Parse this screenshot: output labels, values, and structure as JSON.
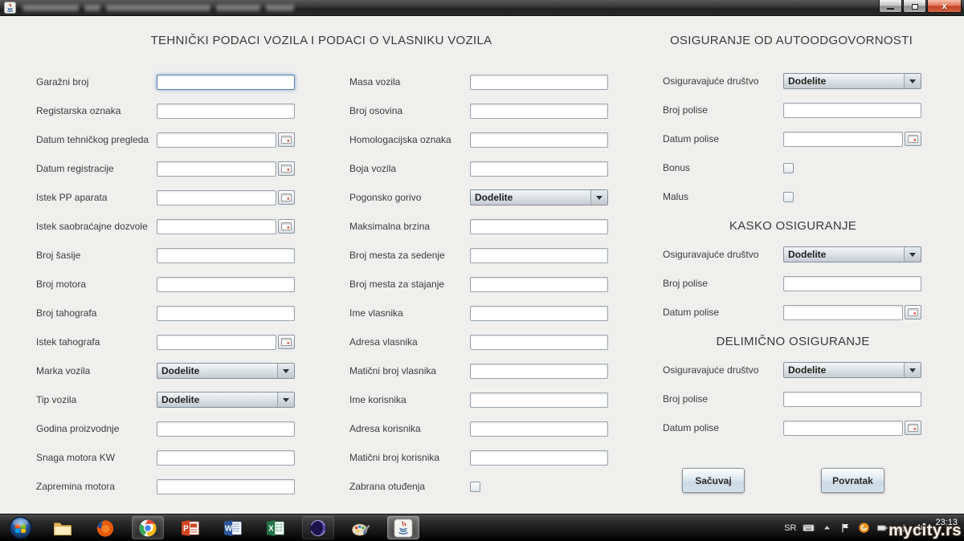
{
  "headings": {
    "main": "TEHNIČKI PODACI VOZILA I PODACI O VLASNIKU VOZILA",
    "autoodgovornost": "OSIGURANJE OD AUTOODGOVORNOSTI"
  },
  "form": {
    "left": [
      {
        "label": "Garažni broj",
        "type": "text",
        "value": "",
        "focused": true
      },
      {
        "label": "Registarska oznaka",
        "type": "text",
        "value": ""
      },
      {
        "label": "Datum tehničkog pregleda",
        "type": "date",
        "value": ""
      },
      {
        "label": "Datum registracije",
        "type": "date",
        "value": ""
      },
      {
        "label": "Istek PP aparata",
        "type": "date",
        "value": ""
      },
      {
        "label": "Istek saobraćajne dozvole",
        "type": "date",
        "value": ""
      },
      {
        "label": "Broj šasije",
        "type": "text",
        "value": ""
      },
      {
        "label": "Broj motora",
        "type": "text",
        "value": ""
      },
      {
        "label": "Broj tahografa",
        "type": "text",
        "value": ""
      },
      {
        "label": "Istek tahografa",
        "type": "date",
        "value": ""
      },
      {
        "label": "Marka vozila",
        "type": "select",
        "value": "Dodelite"
      },
      {
        "label": "Tip vozila",
        "type": "select",
        "value": "Dodelite"
      },
      {
        "label": "Godina proizvodnje",
        "type": "text",
        "value": ""
      },
      {
        "label": "Snaga motora KW",
        "type": "text",
        "value": ""
      },
      {
        "label": "Zapremina motora",
        "type": "text",
        "value": ""
      }
    ],
    "middle": [
      {
        "label": "Masa vozila",
        "type": "text",
        "value": ""
      },
      {
        "label": "Broj osovina",
        "type": "text",
        "value": ""
      },
      {
        "label": "Homologacijska oznaka",
        "type": "text",
        "value": ""
      },
      {
        "label": "Boja vozila",
        "type": "text",
        "value": ""
      },
      {
        "label": "Pogonsko gorivo",
        "type": "select",
        "value": "Dodelite"
      },
      {
        "label": "Maksimalna brzina",
        "type": "text",
        "value": ""
      },
      {
        "label": "Broj mesta za sedenje",
        "type": "text",
        "value": ""
      },
      {
        "label": "Broj mesta za stajanje",
        "type": "text",
        "value": ""
      },
      {
        "label": "Ime vlasnika",
        "type": "text",
        "value": ""
      },
      {
        "label": "Adresa vlasnika",
        "type": "text",
        "value": ""
      },
      {
        "label": "Matični broj vlasnika",
        "type": "text",
        "value": ""
      },
      {
        "label": "Ime korisnika",
        "type": "text",
        "value": ""
      },
      {
        "label": "Adresa korisnika",
        "type": "text",
        "value": ""
      },
      {
        "label": "Matični broj korisnika",
        "type": "text",
        "value": ""
      },
      {
        "label": "Zabrana otuđenja",
        "type": "checkbox",
        "checked": false
      }
    ],
    "right": [
      {
        "label": "Osiguravajuće društvo",
        "type": "select",
        "value": "Dodelite"
      },
      {
        "label": "Broj polise",
        "type": "text",
        "value": ""
      },
      {
        "label": "Datum polise",
        "type": "date",
        "value": ""
      },
      {
        "label": "Bonus",
        "type": "checkbox",
        "checked": false
      },
      {
        "label": "Malus",
        "type": "checkbox",
        "checked": false
      },
      {
        "label": "KASKO OSIGURANJE",
        "type": "section-heading"
      },
      {
        "label": "Osiguravajuće društvo",
        "type": "select",
        "value": "Dodelite"
      },
      {
        "label": "Broj polise",
        "type": "text",
        "value": ""
      },
      {
        "label": "Datum polise",
        "type": "date",
        "value": ""
      },
      {
        "label": "DELIMIČNO OSIGURANJE",
        "type": "section-heading"
      },
      {
        "label": "Osiguravajuće društvo",
        "type": "select",
        "value": "Dodelite"
      },
      {
        "label": "Broj polise",
        "type": "text",
        "value": ""
      },
      {
        "label": "Datum polise",
        "type": "date",
        "value": ""
      }
    ]
  },
  "buttons": {
    "save": "Sačuvaj",
    "back": "Povratak"
  },
  "taskbar": {
    "items": [
      {
        "name": "start-button",
        "icon": "windows-orb",
        "state": ""
      },
      {
        "name": "explorer",
        "icon": "folder",
        "state": ""
      },
      {
        "name": "firefox",
        "icon": "firefox",
        "state": ""
      },
      {
        "name": "chrome",
        "icon": "chrome",
        "state": "active"
      },
      {
        "name": "powerpoint",
        "icon": "powerpoint",
        "state": ""
      },
      {
        "name": "word",
        "icon": "word",
        "state": ""
      },
      {
        "name": "excel",
        "icon": "excel",
        "state": ""
      },
      {
        "name": "eclipse",
        "icon": "eclipse",
        "state": "open"
      },
      {
        "name": "paint",
        "icon": "paint",
        "state": ""
      },
      {
        "name": "java-app",
        "icon": "java",
        "state": "pressed"
      }
    ]
  },
  "tray": {
    "language": "SR",
    "time": "23:13",
    "icons": [
      "keyboard",
      "show-hidden",
      "flag",
      "security-orange",
      "battery",
      "network",
      "volume"
    ]
  },
  "watermark": "mycity.rs"
}
